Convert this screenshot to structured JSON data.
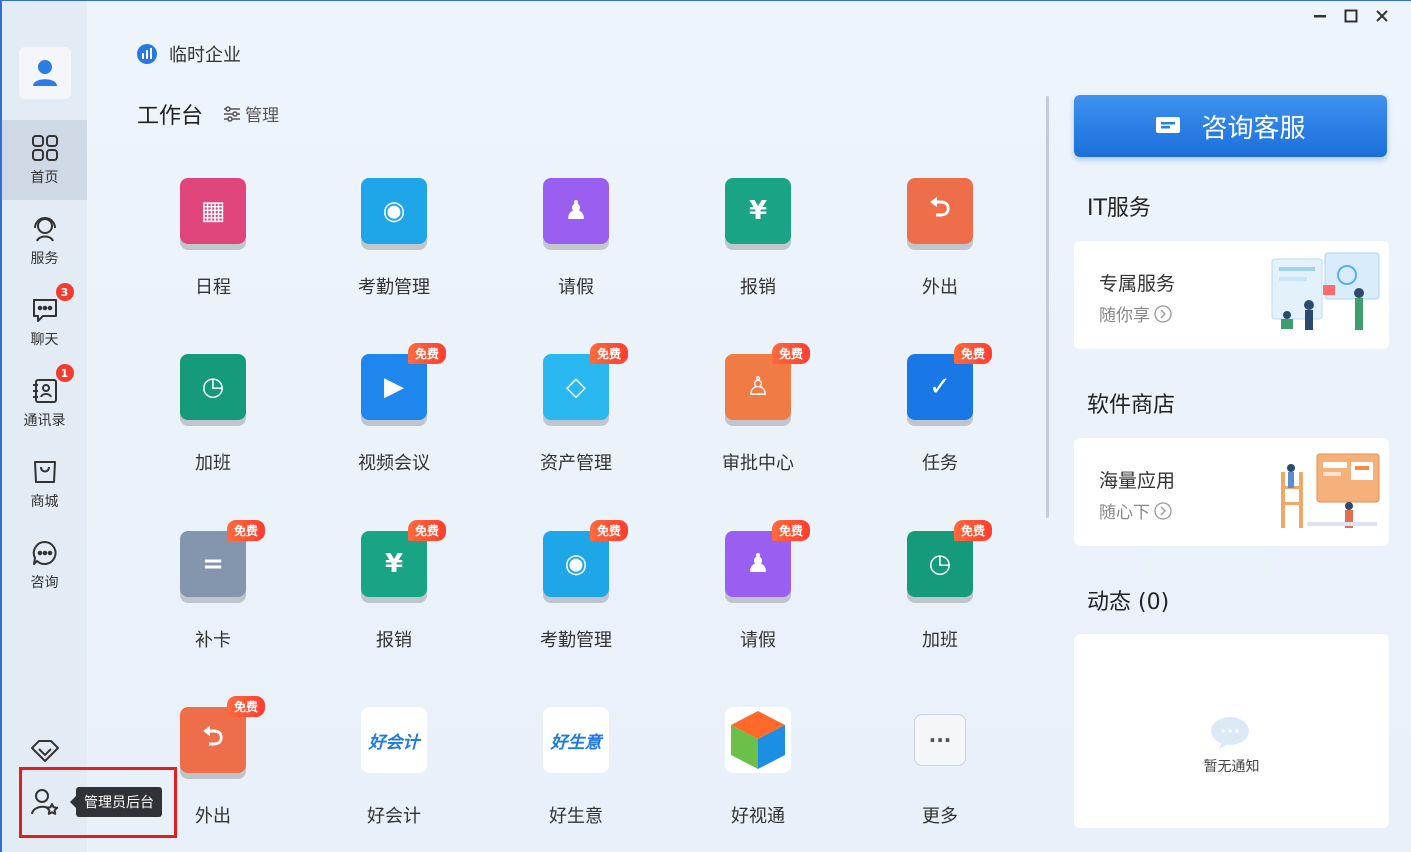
{
  "company": {
    "name": "临时企业"
  },
  "workspace": {
    "title": "工作台",
    "manage_label": "管理"
  },
  "sidebar": {
    "items": [
      {
        "label": "首页",
        "icon": "grid-icon",
        "active": true
      },
      {
        "label": "服务",
        "icon": "service-icon"
      },
      {
        "label": "聊天",
        "icon": "chat-icon",
        "badge": "3"
      },
      {
        "label": "通讯录",
        "icon": "contacts-icon",
        "badge": "1"
      },
      {
        "label": "商城",
        "icon": "shopping-bag-icon"
      },
      {
        "label": "咨询",
        "icon": "consult-icon"
      }
    ],
    "admin_tooltip": "管理员后台"
  },
  "apps": [
    {
      "label": "日程",
      "color": "#e0457b",
      "glyph": "▦",
      "free": false
    },
    {
      "label": "考勤管理",
      "color": "#1fa6e8",
      "glyph": "◉",
      "free": false
    },
    {
      "label": "请假",
      "color": "#9a5ef0",
      "glyph": "♟",
      "free": false
    },
    {
      "label": "报销",
      "color": "#19a486",
      "glyph": "¥",
      "free": false
    },
    {
      "label": "外出",
      "color": "#ee6e4a",
      "glyph": "⮌",
      "free": false
    },
    {
      "label": "加班",
      "color": "#169a7c",
      "glyph": "◷",
      "free": false
    },
    {
      "label": "视频会议",
      "color": "#1f86ee",
      "glyph": "▶",
      "free": true
    },
    {
      "label": "资产管理",
      "color": "#2ab8f0",
      "glyph": "◇",
      "free": true
    },
    {
      "label": "审批中心",
      "color": "#f07b44",
      "glyph": "♙",
      "free": true
    },
    {
      "label": "任务",
      "color": "#1977e6",
      "glyph": "✓",
      "free": true
    },
    {
      "label": "补卡",
      "color": "#8496ad",
      "glyph": "=",
      "free": true
    },
    {
      "label": "报销",
      "color": "#19a486",
      "glyph": "¥",
      "free": true
    },
    {
      "label": "考勤管理",
      "color": "#1fa6e8",
      "glyph": "◉",
      "free": true
    },
    {
      "label": "请假",
      "color": "#9a5ef0",
      "glyph": "♟",
      "free": true
    },
    {
      "label": "加班",
      "color": "#169a7c",
      "glyph": "◷",
      "free": true
    },
    {
      "label": "外出",
      "color": "#ee6e4a",
      "glyph": "⮌",
      "free": true
    },
    {
      "label": "好会计",
      "color": "#ffffff",
      "glyph": "好会计",
      "free": false
    },
    {
      "label": "好生意",
      "color": "#ffffff",
      "glyph": "好生意",
      "free": false
    },
    {
      "label": "好视通",
      "color": "#ffffff",
      "glyph": "cube",
      "free": false
    },
    {
      "label": "更多",
      "color": "#f4f6f9",
      "glyph": "···",
      "free": false
    }
  ],
  "free_badge": "免费",
  "right_panel": {
    "consult_button": "咨询客服",
    "it_service": {
      "title": "IT服务",
      "card_title": "专属服务",
      "card_sub": "随你享"
    },
    "software_store": {
      "title": "软件商店",
      "card_title": "海量应用",
      "card_sub": "随心下"
    },
    "feed": {
      "title": "动态 (0)",
      "empty_text": "暂无通知"
    }
  }
}
